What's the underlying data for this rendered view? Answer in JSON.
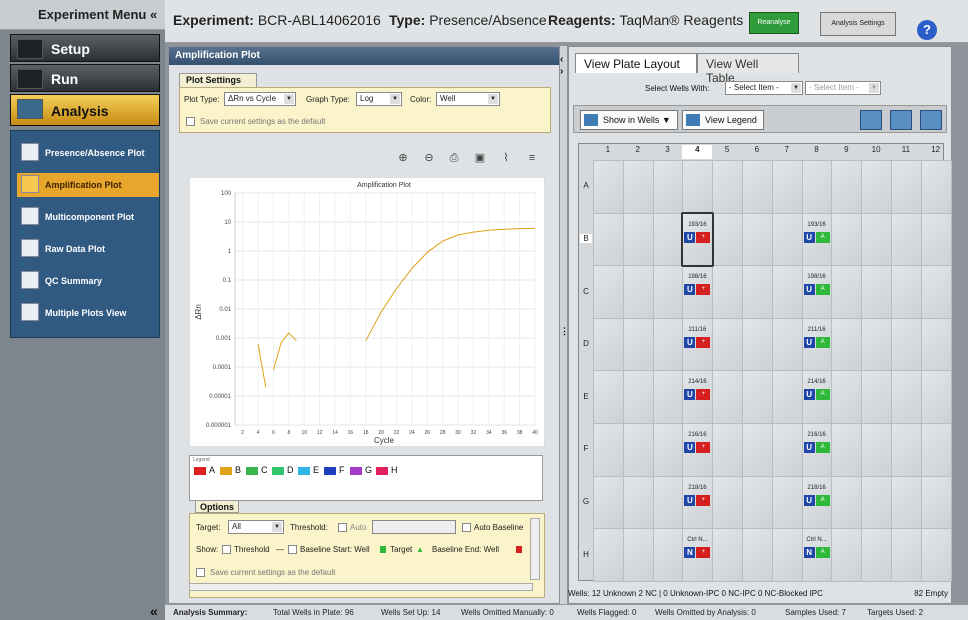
{
  "nav": {
    "title": "Experiment Menu",
    "title_arrow": "«",
    "items": [
      {
        "label": "Setup"
      },
      {
        "label": "Run"
      },
      {
        "label": "Analysis"
      }
    ],
    "sub_items": [
      {
        "label": "Presence/Absence Plot"
      },
      {
        "label": "Amplification Plot"
      },
      {
        "label": "Multicomponent Plot"
      },
      {
        "label": "Raw Data Plot"
      },
      {
        "label": "QC Summary"
      },
      {
        "label": "Multiple Plots View"
      }
    ],
    "collapse": "«"
  },
  "header": {
    "experiment_label": "Experiment:",
    "experiment_value": "BCR-ABL14062016",
    "type_label": "Type:",
    "type_value": "Presence/Absence",
    "reagents_label": "Reagents:",
    "reagents_value": "TaqMan® Reagents",
    "reanalyse": "Reanalyse",
    "analysis_settings": "Analysis Settings",
    "help": "?"
  },
  "amp": {
    "title": "Amplification Plot",
    "plot_settings_tab": "Plot Settings",
    "plot_type_label": "Plot Type:",
    "plot_type_value": "ΔRn vs Cycle",
    "graph_type_label": "Graph Type:",
    "graph_type_value": "Log",
    "color_label": "Color:",
    "color_value": "Well",
    "save_default": "Save current settings as the default",
    "legend_head": "Legend",
    "legend": [
      {
        "label": "A",
        "color": "#e02020"
      },
      {
        "label": "B",
        "color": "#e0a21a"
      },
      {
        "label": "C",
        "color": "#39b54a"
      },
      {
        "label": "D",
        "color": "#2fc36b"
      },
      {
        "label": "E",
        "color": "#2bb8e8"
      },
      {
        "label": "F",
        "color": "#1f3fbf"
      },
      {
        "label": "G",
        "color": "#a23bc9"
      },
      {
        "label": "H",
        "color": "#e0205a"
      }
    ],
    "options_tab": "Options",
    "target_label": "Target:",
    "target_value": "All",
    "threshold_label": "Threshold:",
    "auto_label": "Auto",
    "auto_baseline_label": "Auto Baseline",
    "show_label": "Show:",
    "show_threshold": "Threshold",
    "show_baseline_start": "Baseline Start: Well",
    "show_target": "Target",
    "show_baseline_end": "Baseline End: Well",
    "save_default2": "Save current settings as the default"
  },
  "chart_data": {
    "type": "line",
    "title": "Amplification Plot",
    "xlabel": "Cycle",
    "ylabel": "ΔRn",
    "y_scale": "log",
    "ylim": [
      1e-06,
      100
    ],
    "xlim": [
      1,
      40
    ],
    "x_ticks": [
      "2",
      "4",
      "6",
      "8",
      "10",
      "12",
      "14",
      "16",
      "18",
      "20",
      "22",
      "24",
      "26",
      "28",
      "30",
      "32",
      "34",
      "36",
      "38",
      "40"
    ],
    "y_ticks": [
      "100",
      "10",
      "1",
      "0.1",
      "0.01",
      "0.001",
      "0.0001",
      "0.00001",
      "0.000001"
    ],
    "series_color": "#e0a21a",
    "grid": true,
    "segments": [
      {
        "x": [
          4,
          5
        ],
        "y": [
          0.0006,
          2e-05
        ]
      },
      {
        "x": [
          6,
          7,
          8,
          9
        ],
        "y": [
          8e-05,
          0.0007,
          0.0015,
          0.0008
        ]
      },
      {
        "x": [
          18,
          20,
          22,
          24,
          26,
          28,
          30,
          32,
          34,
          36,
          38,
          40
        ],
        "y": [
          0.0008,
          0.008,
          0.05,
          0.25,
          0.9,
          2.2,
          3.6,
          4.5,
          5.2,
          5.6,
          5.9,
          6.0
        ]
      }
    ]
  },
  "right": {
    "tab_layout": "View Plate Layout",
    "tab_table": "View Well Table",
    "select_wells_label": "Select Wells With:",
    "select_item1": "- Select Item -",
    "select_item2": "- Select Item -",
    "show_in_wells": "Show in Wells ▼",
    "view_legend": "View Legend",
    "summary": "Wells: 12 Unknown 2 NC | 0 Unknown-IPC 0 NC-IPC 0 NC-Blocked IPC",
    "empty": "82 Empty"
  },
  "plate": {
    "cols": [
      "1",
      "2",
      "3",
      "4",
      "5",
      "6",
      "7",
      "8",
      "9",
      "10",
      "11",
      "12"
    ],
    "rows": [
      "A",
      "B",
      "C",
      "D",
      "E",
      "F",
      "G",
      "H"
    ],
    "wells": [
      {
        "row": 1,
        "col": 3,
        "label": "193/16",
        "task": "U",
        "call": "+",
        "color": "#d62020"
      },
      {
        "row": 1,
        "col": 7,
        "label": "193/16",
        "task": "U",
        "call": "A",
        "color": "#2fb83a"
      },
      {
        "row": 2,
        "col": 3,
        "label": "198/16",
        "task": "U",
        "call": "+",
        "color": "#d62020"
      },
      {
        "row": 2,
        "col": 7,
        "label": "198/16",
        "task": "U",
        "call": "A",
        "color": "#2fb83a"
      },
      {
        "row": 3,
        "col": 3,
        "label": "211/16",
        "task": "U",
        "call": "+",
        "color": "#d62020"
      },
      {
        "row": 3,
        "col": 7,
        "label": "211/16",
        "task": "U",
        "call": "A",
        "color": "#2fb83a"
      },
      {
        "row": 4,
        "col": 3,
        "label": "214/16",
        "task": "U",
        "call": "+",
        "color": "#d62020"
      },
      {
        "row": 4,
        "col": 7,
        "label": "214/16",
        "task": "U",
        "call": "A",
        "color": "#2fb83a"
      },
      {
        "row": 5,
        "col": 3,
        "label": "216/16",
        "task": "U",
        "call": "+",
        "color": "#d62020"
      },
      {
        "row": 5,
        "col": 7,
        "label": "216/16",
        "task": "U",
        "call": "A",
        "color": "#2fb83a"
      },
      {
        "row": 6,
        "col": 3,
        "label": "218/16",
        "task": "U",
        "call": "+",
        "color": "#d62020"
      },
      {
        "row": 6,
        "col": 7,
        "label": "218/16",
        "task": "U",
        "call": "A",
        "color": "#2fb83a"
      },
      {
        "row": 7,
        "col": 3,
        "label": "Ctrl N...",
        "task": "N",
        "call": "+",
        "color": "#d62020"
      },
      {
        "row": 7,
        "col": 7,
        "label": "Ctrl N...",
        "task": "N",
        "call": "A",
        "color": "#2fb83a"
      }
    ]
  },
  "footer": {
    "label": "Analysis Summary:",
    "total": "Total Wells in Plate: 96",
    "setup": "Wells Set Up: 14",
    "omitted_manual": "Wells Omitted Manually: 0",
    "flagged": "Wells Flagged: 0",
    "omitted_analysis": "Wells Omitted by Analysis: 0",
    "samples": "Samples Used: 7",
    "targets": "Targets Used: 2"
  }
}
